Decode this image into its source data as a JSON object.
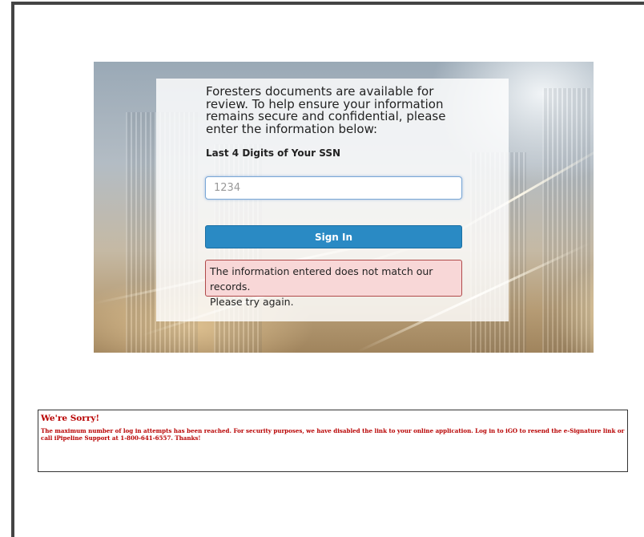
{
  "login": {
    "intro_text": "Foresters documents are available for review. To help ensure your information remains secure and confidential, please enter the information below:",
    "ssn_label": "Last 4 Digits of Your SSN",
    "ssn_input": {
      "value": "",
      "placeholder": "1234"
    },
    "signin_label": "Sign In",
    "error_message_line1": "The information entered does not match our records.",
    "error_message_line2": "Please try again."
  },
  "notice": {
    "title": "We're Sorry!",
    "message": "The maximum number of log in attempts has been reached. For security purposes, we have disabled the link to your online application. Log in to iGO to resend the e-Signature link or call iPipeline Support at 1-800-641-6557. Thanks!"
  },
  "colors": {
    "button": "#2a8ac4",
    "error_bg": "#f8d7d7",
    "error_border": "#b04a4a",
    "notice_text": "#b80000"
  }
}
